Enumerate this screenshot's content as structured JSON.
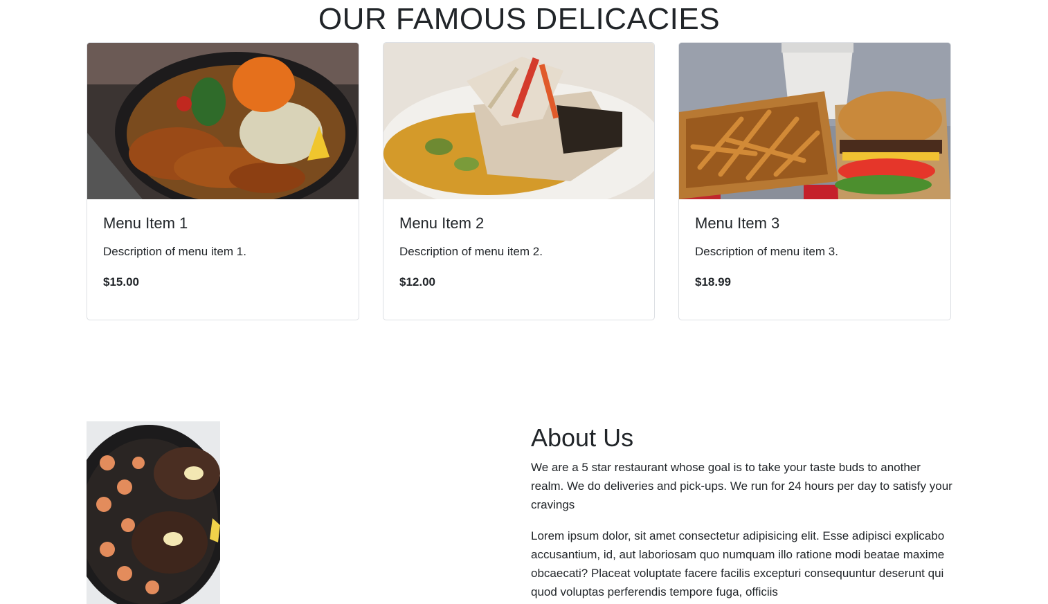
{
  "section": {
    "title": "OUR FAMOUS DELICACIES"
  },
  "menu_items": [
    {
      "title": "Menu Item 1",
      "description": "Description of menu item 1.",
      "price": "$15.00",
      "image_subject": "teriyaki chicken bowl with salad"
    },
    {
      "title": "Menu Item 2",
      "description": "Description of menu item 2.",
      "price": "$12.00",
      "image_subject": "seared fish fillet with vegetables"
    },
    {
      "title": "Menu Item 3",
      "description": "Description of menu item 3.",
      "price": "$18.99",
      "image_subject": "burger with fries and milkshake"
    }
  ],
  "about": {
    "title": "About Us",
    "paragraph1": "We are a 5 star restaurant whose goal is to take your taste buds to another realm. We do deliveries and pick-ups. We run for 24 hours per day to satisfy your cravings",
    "paragraph2": "Lorem ipsum dolor, sit amet consectetur adipisicing elit. Esse adipisci explicabo accusantium, id, aut laboriosam quo numquam illo ratione modi beatae maxime obcaecati? Placeat voluptate facere facilis excepturi consequuntur deserunt qui quod voluptas perferendis tempore fuga, officiis",
    "image_subject": "steak and shrimp in skillet"
  }
}
